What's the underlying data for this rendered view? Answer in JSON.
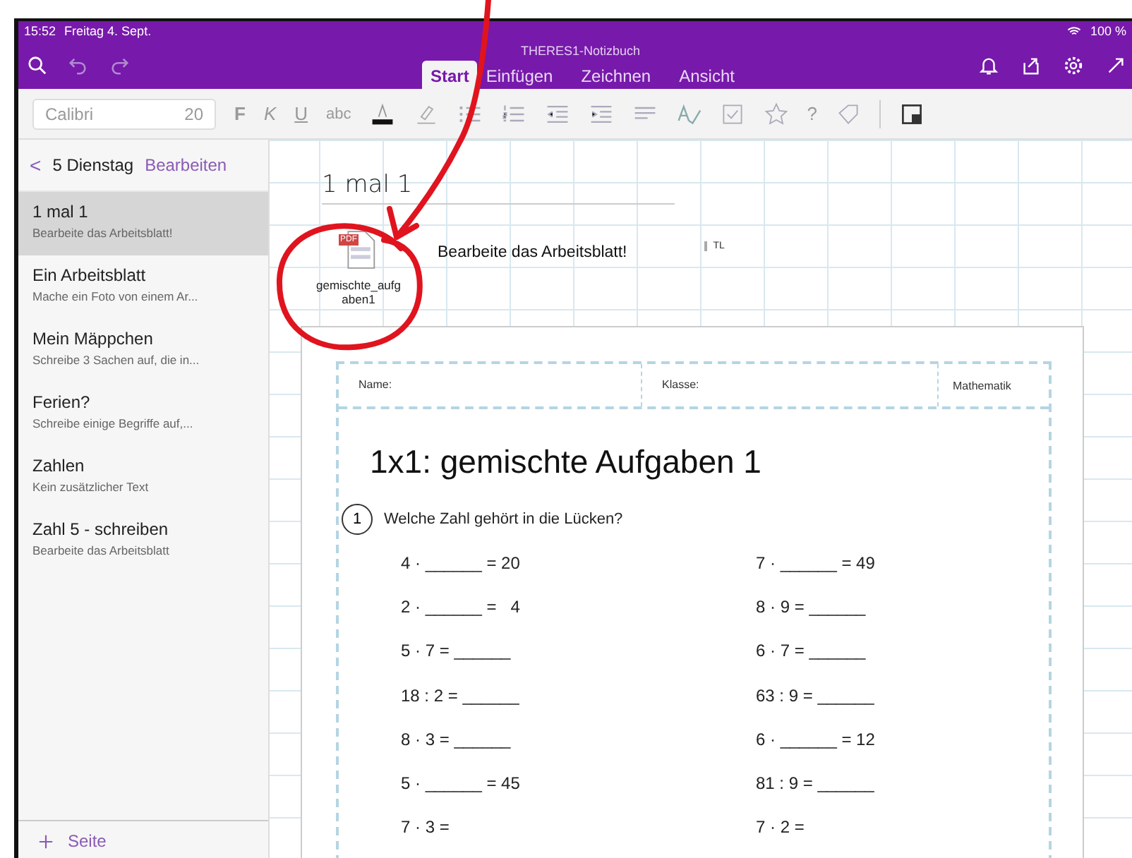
{
  "status_bar": {
    "time": "15:52",
    "date": "Freitag 4. Sept.",
    "battery": "100 %"
  },
  "window": {
    "title": "THERES1-Notizbuch"
  },
  "tabs": [
    {
      "label": "Start",
      "selected": true
    },
    {
      "label": "Einfügen",
      "selected": false
    },
    {
      "label": "Zeichnen",
      "selected": false
    },
    {
      "label": "Ansicht",
      "selected": false
    }
  ],
  "toolbar": {
    "font": "Calibri",
    "size": "20",
    "bold": "F",
    "italic": "K",
    "underline": "U",
    "strike": "abc",
    "help": "?"
  },
  "sidebar": {
    "back": "<",
    "section": "5 Dienstag",
    "edit": "Bearbeiten",
    "pages": [
      {
        "title": "1 mal 1",
        "subtitle": "Bearbeite das Arbeitsblatt!",
        "selected": true
      },
      {
        "title": "Ein Arbeitsblatt",
        "subtitle": "Mache ein Foto von einem Ar...",
        "selected": false
      },
      {
        "title": "Mein Mäppchen",
        "subtitle": "Schreibe 3 Sachen auf, die in...",
        "selected": false
      },
      {
        "title": "Ferien?",
        "subtitle": "Schreibe einige Begriffe auf,...",
        "selected": false
      },
      {
        "title": "Zahlen",
        "subtitle": "Kein zusätzlicher Text",
        "selected": false
      },
      {
        "title": "Zahl 5 - schreiben",
        "subtitle": "Bearbeite das Arbeitsblatt",
        "selected": false
      }
    ],
    "add_page": "Seite"
  },
  "page": {
    "title": "1 mal 1",
    "attachment": {
      "badge": "PDF",
      "name": "gemischte_aufgaben1"
    },
    "note": "Bearbeite das Arbeitsblatt!",
    "marker": "TL",
    "worksheet": {
      "name_label": "Name:",
      "class_label": "Klasse:",
      "subject": "Mathematik",
      "title": "1x1: gemischte Aufgaben 1",
      "task_number": "1",
      "task": "Welche Zahl gehört in die Lücken?",
      "equations": [
        [
          "4 · ______ = 20",
          "7 · ______ = 49"
        ],
        [
          "2 · ______ =   4",
          "8 · 9 = ______"
        ],
        [
          "5 · 7 = ______",
          "6 · 7 = ______"
        ],
        [
          "18 : 2 = ______",
          "63 : 9 = ______"
        ],
        [
          "8 · 3 = ______",
          "6 · ______ = 12"
        ],
        [
          "5 · ______ = 45",
          "81 : 9 = ______"
        ],
        [
          "7 · 3 =",
          "7 · 2 ="
        ]
      ]
    }
  }
}
